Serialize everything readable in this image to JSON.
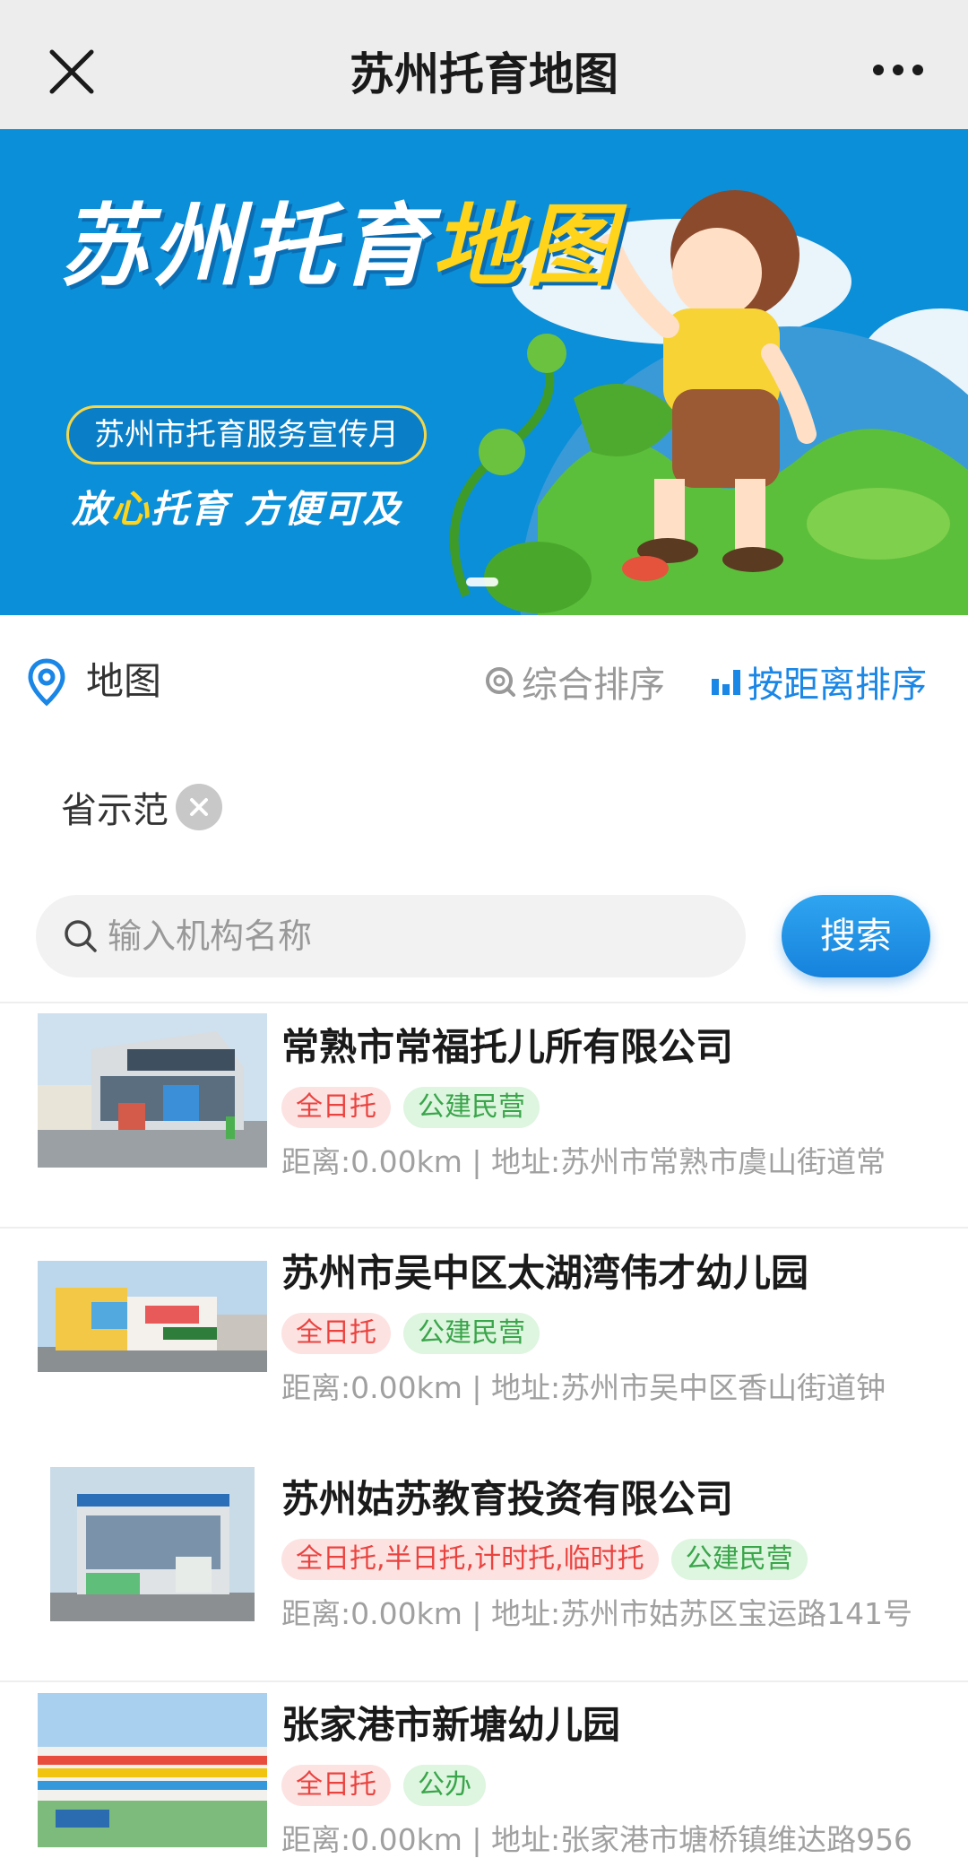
{
  "nav": {
    "title": "苏州托育地图",
    "close_icon": "close-icon",
    "more_icon": "more-icon"
  },
  "banner": {
    "title_main": "苏州托育",
    "title_highlight": "地图",
    "pill": "苏州市托育服务宣传月",
    "slogan_part1": "放",
    "slogan_highlight": "心",
    "slogan_part2": "托育  方便可及"
  },
  "filter": {
    "map_label": "地图",
    "sort_composite": "综合排序",
    "sort_distance": "按距离排序",
    "active_sort_color": "#1a86e6"
  },
  "chip": {
    "label": "省示范"
  },
  "search": {
    "placeholder": "输入机构名称",
    "button_label": "搜索"
  },
  "list": [
    {
      "title": "常熟市常福托儿所有限公司",
      "tags": [
        {
          "text": "全日托",
          "color": "red"
        },
        {
          "text": "公建民营",
          "color": "green"
        }
      ],
      "address": "距离:0.00km | 地址:苏州市常熟市虞山街道常"
    },
    {
      "title": "苏州市吴中区太湖湾伟才幼儿园",
      "tags": [
        {
          "text": "全日托",
          "color": "red"
        },
        {
          "text": "公建民营",
          "color": "green"
        }
      ],
      "address": "距离:0.00km | 地址:苏州市吴中区香山街道钟"
    },
    {
      "title": "苏州姑苏教育投资有限公司",
      "tags": [
        {
          "text": "全日托,半日托,计时托,临时托",
          "color": "red"
        },
        {
          "text": "公建民营",
          "color": "green"
        }
      ],
      "address": "距离:0.00km | 地址:苏州市姑苏区宝运路141号"
    },
    {
      "title": "张家港市新塘幼儿园",
      "tags": [
        {
          "text": "全日托",
          "color": "red"
        },
        {
          "text": "公办",
          "color": "green"
        }
      ],
      "address": "距离:0.00km | 地址:张家港市塘桥镇维达路956"
    }
  ]
}
